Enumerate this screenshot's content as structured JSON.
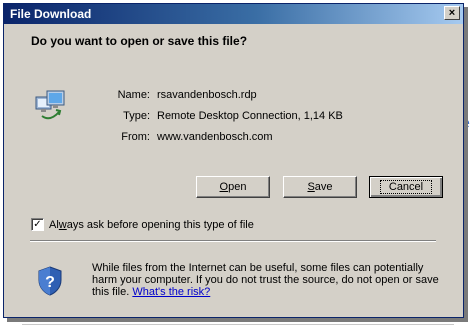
{
  "window": {
    "title": "File Download",
    "close_glyph": "×"
  },
  "question": "Do you want to open or save this file?",
  "file": {
    "icon": "remote-desktop-file-icon",
    "name_label": "Name:",
    "name_value": "rsavandenbosch.rdp",
    "type_label": "Type:",
    "type_value": "Remote Desktop Connection, 1,14 KB",
    "from_label": "From:",
    "from_value": "www.vandenbosch.com"
  },
  "buttons": {
    "open_prefix": "",
    "open_mnemonic": "O",
    "open_rest": "pen",
    "save_prefix": "",
    "save_mnemonic": "S",
    "save_rest": "ave",
    "cancel": "Cancel"
  },
  "checkbox": {
    "checked": true,
    "check_glyph": "✓",
    "label_prefix": "Al",
    "label_mnemonic": "w",
    "label_rest": "ays ask before opening this type of file"
  },
  "warning": {
    "icon": "security-shield-question-icon",
    "text": "While files from the Internet can be useful, some files can potentially harm your computer. If you do not trust the source, do not open or save this file. ",
    "link": "What's the risk?"
  },
  "background": {
    "fragment": "e"
  },
  "colors": {
    "titlebar_start": "#0a246a",
    "titlebar_end": "#a6caf0",
    "dialog_face": "#d4d0c8",
    "link": "#0000cc"
  }
}
